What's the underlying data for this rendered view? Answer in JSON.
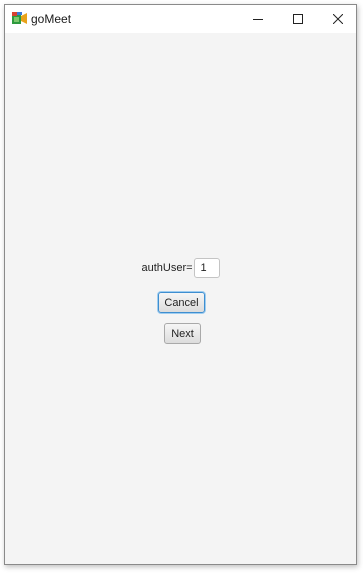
{
  "window": {
    "title": "goMeet",
    "controls": {
      "minimize_icon": "minimize-icon",
      "maximize_icon": "maximize-icon",
      "close_icon": "close-icon"
    }
  },
  "form": {
    "auth_label": "authUser=",
    "auth_value": "1",
    "cancel_label": "Cancel",
    "next_label": "Next"
  },
  "colors": {
    "window_background": "#f4f4f4",
    "titlebar": "#ffffff",
    "focus_border": "#3e8ed0"
  }
}
